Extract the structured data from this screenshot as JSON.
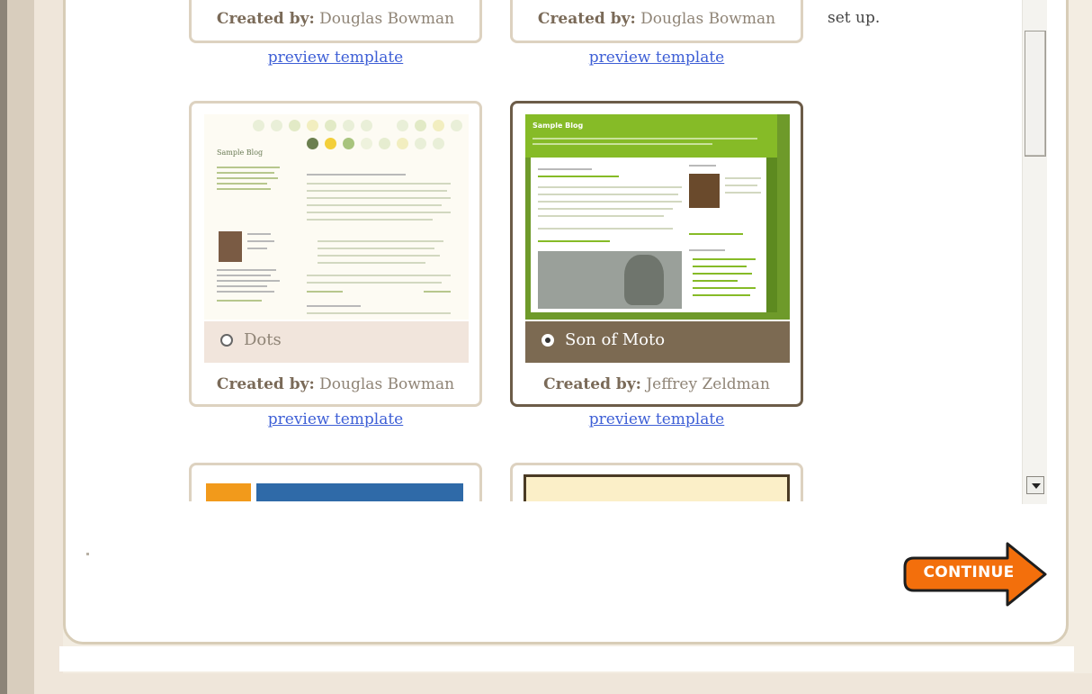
{
  "templates_row1": [
    {
      "created_by_key": "Created by:",
      "author": "Douglas Bowman",
      "preview_label": "preview template"
    },
    {
      "created_by_key": "Created by:",
      "author": "Douglas Bowman",
      "preview_label": "preview template"
    }
  ],
  "side_text": "set up.",
  "templates_row2": [
    {
      "name": "Dots",
      "selected": false,
      "created_by_key": "Created by:",
      "author": "Douglas Bowman",
      "preview_label": "preview template",
      "thumb_title": "Sample Blog"
    },
    {
      "name": "Son of Moto",
      "selected": true,
      "created_by_key": "Created by:",
      "author": "Jeffrey Zeldman",
      "preview_label": "preview template",
      "thumb_title": "Sample Blog"
    }
  ],
  "continue_label": "CONTINUE",
  "colors": {
    "accent_orange": "#f36f0c",
    "link_blue": "#3e5fd6",
    "selected_border": "#6c5c48",
    "moto_green": "#86bb27"
  },
  "icons": [
    "radio-unchecked-icon",
    "radio-checked-icon",
    "scroll-down-arrow-icon",
    "continue-arrow-icon"
  ]
}
